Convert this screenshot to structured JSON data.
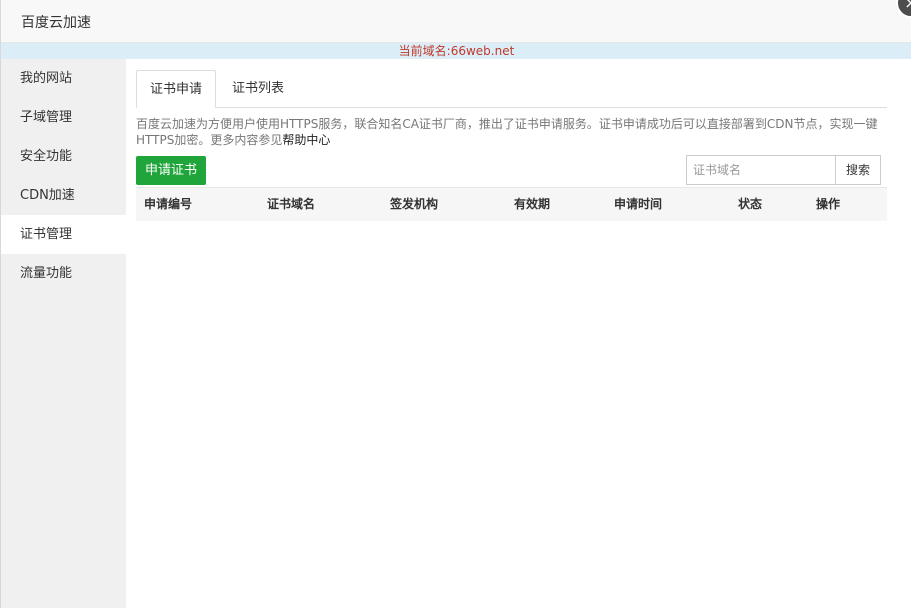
{
  "window": {
    "title": "百度云加速"
  },
  "domain_bar": {
    "text": "当前域名:66web.net"
  },
  "sidebar": {
    "items": [
      {
        "label": "我的网站"
      },
      {
        "label": "子域管理"
      },
      {
        "label": "安全功能"
      },
      {
        "label": "CDN加速"
      },
      {
        "label": "证书管理",
        "active": true
      },
      {
        "label": "流量功能"
      }
    ]
  },
  "tabs": [
    {
      "label": "证书申请",
      "active": true
    },
    {
      "label": "证书列表"
    }
  ],
  "description": {
    "text": "百度云加速为方便用户使用HTTPS服务，联合知名CA证书厂商，推出了证书申请服务。证书申请成功后可以直接部署到CDN节点，实现一键HTTPS加密。更多内容参见",
    "help_link": "帮助中心"
  },
  "toolbar": {
    "apply_label": "申请证书",
    "search_placeholder": "证书域名",
    "search_value": "",
    "search_label": "搜索"
  },
  "table": {
    "headers": [
      "申请编号",
      "证书域名",
      "签发机构",
      "有效期",
      "申请时间",
      "状态",
      "操作"
    ],
    "rows": []
  },
  "colors": {
    "accent": "#20a53a",
    "domain_text": "#c0392b",
    "domain_bar_bg": "#dbeef7"
  }
}
